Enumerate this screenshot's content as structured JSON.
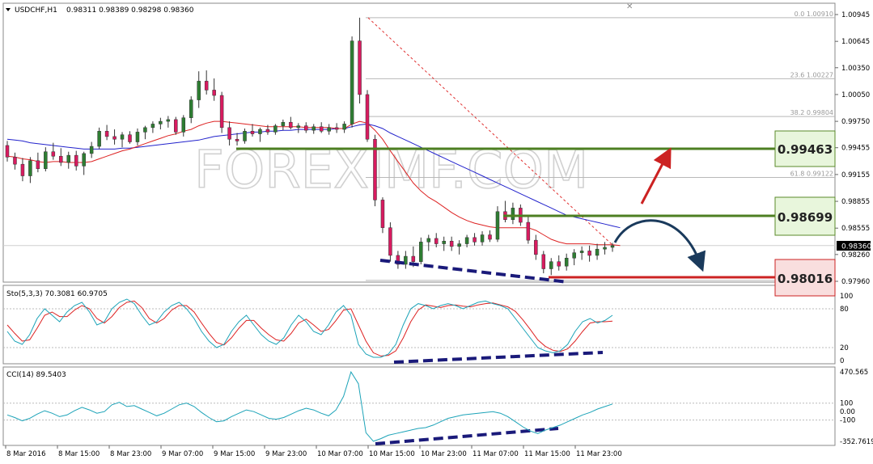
{
  "window": {
    "title": "USDCHF,H1",
    "ohlc": "0.98311 0.98389 0.98298 0.98360"
  },
  "watermark": "FOREXIMF.COM",
  "chart_data": [
    {
      "type": "candlestick",
      "symbol": "USDCHF",
      "timeframe": "H1",
      "ylim": [
        0.9796,
        1.00945
      ],
      "y_ticks": [
        "1.00945",
        "1.00645",
        "1.00350",
        "1.00050",
        "0.99750",
        "0.99455",
        "0.99155",
        "0.98855",
        "0.98555",
        "0.98260",
        "0.97960"
      ],
      "current_price": "0.98360",
      "fibonacci": [
        {
          "level": "0.0",
          "price": "1.00910"
        },
        {
          "level": "23.6",
          "price": "1.00227"
        },
        {
          "level": "38.2",
          "price": "0.99804"
        },
        {
          "level": "61.8",
          "price": "0.99122"
        }
      ],
      "key_levels": [
        {
          "label": "0.99463",
          "role": "resistance",
          "color": "#5a8a2a"
        },
        {
          "label": "0.98699",
          "role": "resistance",
          "color": "#5a8a2a"
        },
        {
          "label": "0.98016",
          "role": "support",
          "color": "#cc2222"
        }
      ],
      "candles": [
        {
          "o": 0.9948,
          "h": 0.9953,
          "l": 0.993,
          "c": 0.9935
        },
        {
          "o": 0.9935,
          "h": 0.994,
          "l": 0.9921,
          "c": 0.9927
        },
        {
          "o": 0.9927,
          "h": 0.9934,
          "l": 0.9908,
          "c": 0.9914
        },
        {
          "o": 0.9914,
          "h": 0.9935,
          "l": 0.9906,
          "c": 0.9931
        },
        {
          "o": 0.9931,
          "h": 0.994,
          "l": 0.9918,
          "c": 0.9922
        },
        {
          "o": 0.9922,
          "h": 0.9946,
          "l": 0.9919,
          "c": 0.9941
        },
        {
          "o": 0.9941,
          "h": 0.9951,
          "l": 0.9932,
          "c": 0.9936
        },
        {
          "o": 0.9936,
          "h": 0.9945,
          "l": 0.9925,
          "c": 0.9929
        },
        {
          "o": 0.9929,
          "h": 0.9941,
          "l": 0.9922,
          "c": 0.9937
        },
        {
          "o": 0.9937,
          "h": 0.9942,
          "l": 0.992,
          "c": 0.9925
        },
        {
          "o": 0.9925,
          "h": 0.9941,
          "l": 0.9915,
          "c": 0.9939
        },
        {
          "o": 0.9939,
          "h": 0.9952,
          "l": 0.9934,
          "c": 0.9947
        },
        {
          "o": 0.9947,
          "h": 0.9968,
          "l": 0.9944,
          "c": 0.9964
        },
        {
          "o": 0.9964,
          "h": 0.9971,
          "l": 0.9954,
          "c": 0.9958
        },
        {
          "o": 0.9958,
          "h": 0.9966,
          "l": 0.9949,
          "c": 0.9955
        },
        {
          "o": 0.9955,
          "h": 0.9963,
          "l": 0.9946,
          "c": 0.996
        },
        {
          "o": 0.996,
          "h": 0.9964,
          "l": 0.995,
          "c": 0.9952
        },
        {
          "o": 0.9952,
          "h": 0.9967,
          "l": 0.9948,
          "c": 0.9963
        },
        {
          "o": 0.9963,
          "h": 0.997,
          "l": 0.9955,
          "c": 0.9968
        },
        {
          "o": 0.9968,
          "h": 0.9975,
          "l": 0.9962,
          "c": 0.9972
        },
        {
          "o": 0.9972,
          "h": 0.9979,
          "l": 0.9966,
          "c": 0.9975
        },
        {
          "o": 0.9975,
          "h": 0.9981,
          "l": 0.9968,
          "c": 0.9977
        },
        {
          "o": 0.9977,
          "h": 0.998,
          "l": 0.996,
          "c": 0.9963
        },
        {
          "o": 0.9963,
          "h": 0.9982,
          "l": 0.9958,
          "c": 0.9979
        },
        {
          "o": 0.9979,
          "h": 1.0003,
          "l": 0.9973,
          "c": 0.9999
        },
        {
          "o": 0.9999,
          "h": 1.0031,
          "l": 0.999,
          "c": 1.002
        },
        {
          "o": 1.002,
          "h": 1.0032,
          "l": 1.0005,
          "c": 1.001
        },
        {
          "o": 1.001,
          "h": 1.0023,
          "l": 0.9998,
          "c": 1.0004
        },
        {
          "o": 1.0004,
          "h": 1.0008,
          "l": 0.9962,
          "c": 0.9968
        },
        {
          "o": 0.9968,
          "h": 0.9975,
          "l": 0.9948,
          "c": 0.9955
        },
        {
          "o": 0.9955,
          "h": 0.9962,
          "l": 0.9948,
          "c": 0.9953
        },
        {
          "o": 0.9953,
          "h": 0.9967,
          "l": 0.995,
          "c": 0.9964
        },
        {
          "o": 0.9964,
          "h": 0.9972,
          "l": 0.9958,
          "c": 0.9961
        },
        {
          "o": 0.9961,
          "h": 0.9968,
          "l": 0.9952,
          "c": 0.9966
        },
        {
          "o": 0.9966,
          "h": 0.9971,
          "l": 0.996,
          "c": 0.9963
        },
        {
          "o": 0.9963,
          "h": 0.9972,
          "l": 0.996,
          "c": 0.997
        },
        {
          "o": 0.997,
          "h": 0.9977,
          "l": 0.9965,
          "c": 0.9974
        },
        {
          "o": 0.9974,
          "h": 0.998,
          "l": 0.9966,
          "c": 0.9968
        },
        {
          "o": 0.9968,
          "h": 0.9973,
          "l": 0.9962,
          "c": 0.997
        },
        {
          "o": 0.997,
          "h": 0.9974,
          "l": 0.9962,
          "c": 0.9965
        },
        {
          "o": 0.9965,
          "h": 0.9972,
          "l": 0.9961,
          "c": 0.9969
        },
        {
          "o": 0.9969,
          "h": 0.9974,
          "l": 0.9962,
          "c": 0.9964
        },
        {
          "o": 0.9964,
          "h": 0.9972,
          "l": 0.996,
          "c": 0.9968
        },
        {
          "o": 0.9968,
          "h": 0.9973,
          "l": 0.9962,
          "c": 0.9966
        },
        {
          "o": 0.9966,
          "h": 0.9975,
          "l": 0.9962,
          "c": 0.9972
        },
        {
          "o": 0.9972,
          "h": 1.007,
          "l": 0.9968,
          "c": 1.0065
        },
        {
          "o": 1.0065,
          "h": 1.0091,
          "l": 0.9995,
          "c": 1.0005
        },
        {
          "o": 1.0005,
          "h": 1.001,
          "l": 0.9952,
          "c": 0.9955
        },
        {
          "o": 0.9955,
          "h": 0.996,
          "l": 0.988,
          "c": 0.9887
        },
        {
          "o": 0.9887,
          "h": 0.989,
          "l": 0.985,
          "c": 0.9856
        },
        {
          "o": 0.9856,
          "h": 0.9862,
          "l": 0.9818,
          "c": 0.9825
        },
        {
          "o": 0.9825,
          "h": 0.983,
          "l": 0.981,
          "c": 0.9815
        },
        {
          "o": 0.9815,
          "h": 0.983,
          "l": 0.981,
          "c": 0.9824
        },
        {
          "o": 0.9824,
          "h": 0.9835,
          "l": 0.9812,
          "c": 0.9818
        },
        {
          "o": 0.9818,
          "h": 0.9845,
          "l": 0.9815,
          "c": 0.984
        },
        {
          "o": 0.984,
          "h": 0.9848,
          "l": 0.983,
          "c": 0.9844
        },
        {
          "o": 0.9844,
          "h": 0.985,
          "l": 0.9834,
          "c": 0.9838
        },
        {
          "o": 0.9838,
          "h": 0.9846,
          "l": 0.983,
          "c": 0.9841
        },
        {
          "o": 0.9841,
          "h": 0.9846,
          "l": 0.983,
          "c": 0.9835
        },
        {
          "o": 0.9835,
          "h": 0.9842,
          "l": 0.9826,
          "c": 0.9838
        },
        {
          "o": 0.9838,
          "h": 0.9848,
          "l": 0.9834,
          "c": 0.9845
        },
        {
          "o": 0.9845,
          "h": 0.985,
          "l": 0.9836,
          "c": 0.984
        },
        {
          "o": 0.984,
          "h": 0.9852,
          "l": 0.9836,
          "c": 0.9848
        },
        {
          "o": 0.9848,
          "h": 0.9853,
          "l": 0.984,
          "c": 0.9843
        },
        {
          "o": 0.9843,
          "h": 0.988,
          "l": 0.984,
          "c": 0.9874
        },
        {
          "o": 0.9874,
          "h": 0.9886,
          "l": 0.9862,
          "c": 0.9865
        },
        {
          "o": 0.9865,
          "h": 0.9884,
          "l": 0.986,
          "c": 0.9878
        },
        {
          "o": 0.9878,
          "h": 0.9882,
          "l": 0.9858,
          "c": 0.9862
        },
        {
          "o": 0.9862,
          "h": 0.987,
          "l": 0.9838,
          "c": 0.9842
        },
        {
          "o": 0.9842,
          "h": 0.9848,
          "l": 0.982,
          "c": 0.9826
        },
        {
          "o": 0.9826,
          "h": 0.983,
          "l": 0.9805,
          "c": 0.981
        },
        {
          "o": 0.981,
          "h": 0.9822,
          "l": 0.9803,
          "c": 0.9818
        },
        {
          "o": 0.9818,
          "h": 0.9825,
          "l": 0.9808,
          "c": 0.9813
        },
        {
          "o": 0.9813,
          "h": 0.9827,
          "l": 0.9808,
          "c": 0.9822
        },
        {
          "o": 0.9822,
          "h": 0.9832,
          "l": 0.9814,
          "c": 0.9828
        },
        {
          "o": 0.9828,
          "h": 0.9835,
          "l": 0.982,
          "c": 0.983
        },
        {
          "o": 0.983,
          "h": 0.9836,
          "l": 0.9818,
          "c": 0.9825
        },
        {
          "o": 0.9825,
          "h": 0.9838,
          "l": 0.982,
          "c": 0.9832
        },
        {
          "o": 0.9832,
          "h": 0.984,
          "l": 0.9826,
          "c": 0.9834
        },
        {
          "o": 0.9834,
          "h": 0.9839,
          "l": 0.9829,
          "c": 0.9836
        }
      ],
      "ma_fast": [
        0.9936,
        0.9935,
        0.9933,
        0.9932,
        0.993,
        0.9929,
        0.993,
        0.993,
        0.9929,
        0.9929,
        0.9929,
        0.993,
        0.9933,
        0.9936,
        0.9939,
        0.9942,
        0.9944,
        0.9947,
        0.995,
        0.9953,
        0.9956,
        0.9959,
        0.9961,
        0.9964,
        0.9966,
        0.997,
        0.9973,
        0.9975,
        0.9975,
        0.9974,
        0.9973,
        0.9972,
        0.9971,
        0.997,
        0.9969,
        0.9969,
        0.9969,
        0.9969,
        0.9969,
        0.9968,
        0.9968,
        0.9968,
        0.9968,
        0.9967,
        0.9967,
        0.9972,
        0.9975,
        0.9973,
        0.9965,
        0.9955,
        0.9942,
        0.993,
        0.9918,
        0.9906,
        0.9897,
        0.989,
        0.9885,
        0.9879,
        0.9873,
        0.9868,
        0.9864,
        0.9861,
        0.9859,
        0.9857,
        0.9856,
        0.9856,
        0.9856,
        0.9856,
        0.9856,
        0.9853,
        0.9848,
        0.9843,
        0.984,
        0.9838,
        0.9838,
        0.9838,
        0.9838,
        0.9837,
        0.9837,
        0.9837,
        0.9836
      ],
      "ma_slow": [
        0.9955,
        0.9954,
        0.9953,
        0.9951,
        0.995,
        0.9949,
        0.9948,
        0.9947,
        0.9946,
        0.9945,
        0.9944,
        0.9944,
        0.9944,
        0.9944,
        0.9944,
        0.9945,
        0.9945,
        0.9946,
        0.9947,
        0.9948,
        0.9949,
        0.995,
        0.9951,
        0.9952,
        0.9953,
        0.9954,
        0.9956,
        0.9958,
        0.9959,
        0.996,
        0.9961,
        0.9962,
        0.9963,
        0.9963,
        0.9964,
        0.9964,
        0.9965,
        0.9965,
        0.9966,
        0.9966,
        0.9966,
        0.9966,
        0.9966,
        0.9967,
        0.9967,
        0.9969,
        0.9971,
        0.9972,
        0.997,
        0.9967,
        0.9962,
        0.9958,
        0.9954,
        0.995,
        0.9946,
        0.9942,
        0.9938,
        0.9934,
        0.993,
        0.9926,
        0.9922,
        0.9918,
        0.9914,
        0.991,
        0.9906,
        0.9902,
        0.9898,
        0.9894,
        0.989,
        0.9886,
        0.9882,
        0.9878,
        0.9874,
        0.987,
        0.9868,
        0.9866,
        0.9864,
        0.9862,
        0.986,
        0.9858,
        0.9856
      ]
    },
    {
      "type": "line",
      "name": "Sto(5,3,3)",
      "header": "Sto(5,3,3) 70.3081 60.9705",
      "ylim": [
        0,
        100
      ],
      "y_ticks": [
        "100",
        "80",
        "20",
        "0"
      ],
      "levels": [
        80,
        20
      ],
      "main": [
        45,
        30,
        25,
        40,
        65,
        80,
        70,
        60,
        75,
        85,
        90,
        75,
        55,
        60,
        80,
        90,
        95,
        88,
        70,
        55,
        60,
        75,
        85,
        90,
        80,
        65,
        45,
        30,
        20,
        25,
        45,
        60,
        70,
        55,
        40,
        30,
        25,
        35,
        55,
        70,
        60,
        45,
        40,
        55,
        75,
        85,
        70,
        25,
        10,
        5,
        5,
        10,
        25,
        55,
        80,
        88,
        85,
        80,
        85,
        88,
        85,
        80,
        85,
        90,
        92,
        88,
        85,
        80,
        65,
        50,
        35,
        20,
        15,
        12,
        15,
        25,
        45,
        60,
        65,
        58,
        62,
        70
      ],
      "signal": [
        55,
        42,
        30,
        32,
        50,
        70,
        75,
        68,
        68,
        78,
        85,
        80,
        65,
        58,
        68,
        82,
        90,
        92,
        82,
        65,
        58,
        65,
        78,
        85,
        85,
        75,
        58,
        42,
        28,
        24,
        35,
        50,
        62,
        62,
        50,
        40,
        32,
        30,
        42,
        58,
        64,
        55,
        45,
        48,
        62,
        78,
        80,
        55,
        30,
        12,
        7,
        8,
        15,
        35,
        60,
        78,
        86,
        84,
        82,
        85,
        86,
        84,
        83,
        86,
        88,
        89,
        86,
        83,
        76,
        63,
        48,
        32,
        22,
        16,
        14,
        18,
        30,
        45,
        58,
        60,
        60,
        61
      ],
      "colors": {
        "main": "#1ca3b8",
        "signal": "#dd2222"
      }
    },
    {
      "type": "line",
      "name": "CCI(14)",
      "header": "CCI(14) 89.5403",
      "ylim": [
        -352.7619,
        470.5653
      ],
      "y_ticks": [
        "470.565",
        "100",
        "0.00",
        "-100",
        "-352.7619"
      ],
      "levels": [
        100,
        -100
      ],
      "values": [
        -40,
        -70,
        -110,
        -80,
        -30,
        10,
        -20,
        -60,
        -40,
        10,
        50,
        20,
        -20,
        0,
        80,
        110,
        60,
        70,
        30,
        -10,
        -50,
        -20,
        30,
        80,
        100,
        60,
        -10,
        -70,
        -120,
        -110,
        -60,
        -20,
        20,
        0,
        -40,
        -80,
        -90,
        -70,
        -30,
        10,
        40,
        20,
        -20,
        -50,
        20,
        180,
        470,
        330,
        -250,
        -352,
        -320,
        -280,
        -260,
        -240,
        -220,
        -200,
        -190,
        -160,
        -120,
        -80,
        -60,
        -40,
        -30,
        -20,
        -10,
        0,
        -20,
        -60,
        -120,
        -180,
        -230,
        -260,
        -220,
        -190,
        -160,
        -120,
        -80,
        -40,
        -10,
        30,
        60,
        90
      ],
      "color": "#1ca3b8"
    }
  ],
  "time_axis": [
    "8 Mar 2016",
    "8 Mar 15:00",
    "8 Mar 23:00",
    "9 Mar 07:00",
    "9 Mar 15:00",
    "9 Mar 23:00",
    "10 Mar 07:00",
    "10 Mar 15:00",
    "10 Mar 23:00",
    "11 Mar 07:00",
    "11 Mar 15:00",
    "11 Mar 23:00"
  ]
}
